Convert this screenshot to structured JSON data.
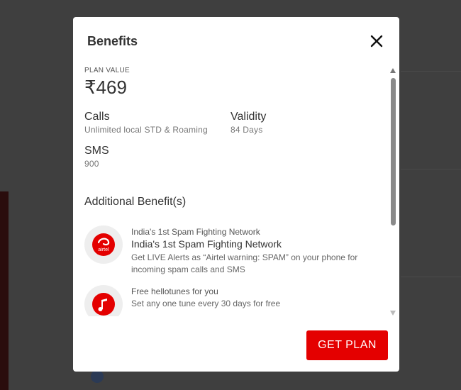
{
  "modal": {
    "title": "Benefits",
    "close_icon": "close-icon",
    "plan": {
      "label": "PLAN VALUE",
      "price": "₹469"
    },
    "benefits": {
      "calls": {
        "title": "Calls",
        "value": "Unlimited local STD & Roaming"
      },
      "validity": {
        "title": "Validity",
        "value": "84 Days"
      },
      "sms": {
        "title": "SMS",
        "value": "900"
      }
    },
    "additional": {
      "title": "Additional Benefit(s)",
      "items": [
        {
          "icon": "airtel-logo-icon",
          "icon_text": "airtel",
          "label": "India's 1st Spam Fighting Network",
          "heading": "India's 1st Spam Fighting Network",
          "desc": "Get LIVE Alerts as “Airtel warning: SPAM” on your phone for incoming spam calls and SMS"
        },
        {
          "icon": "hellotunes-icon",
          "label": "Free hellotunes for you",
          "desc": "Set any one tune every 30 days for free"
        }
      ]
    },
    "cta_label": "GET PLAN",
    "colors": {
      "brand": "#e40000",
      "overlay": "#3f3f3f"
    }
  }
}
